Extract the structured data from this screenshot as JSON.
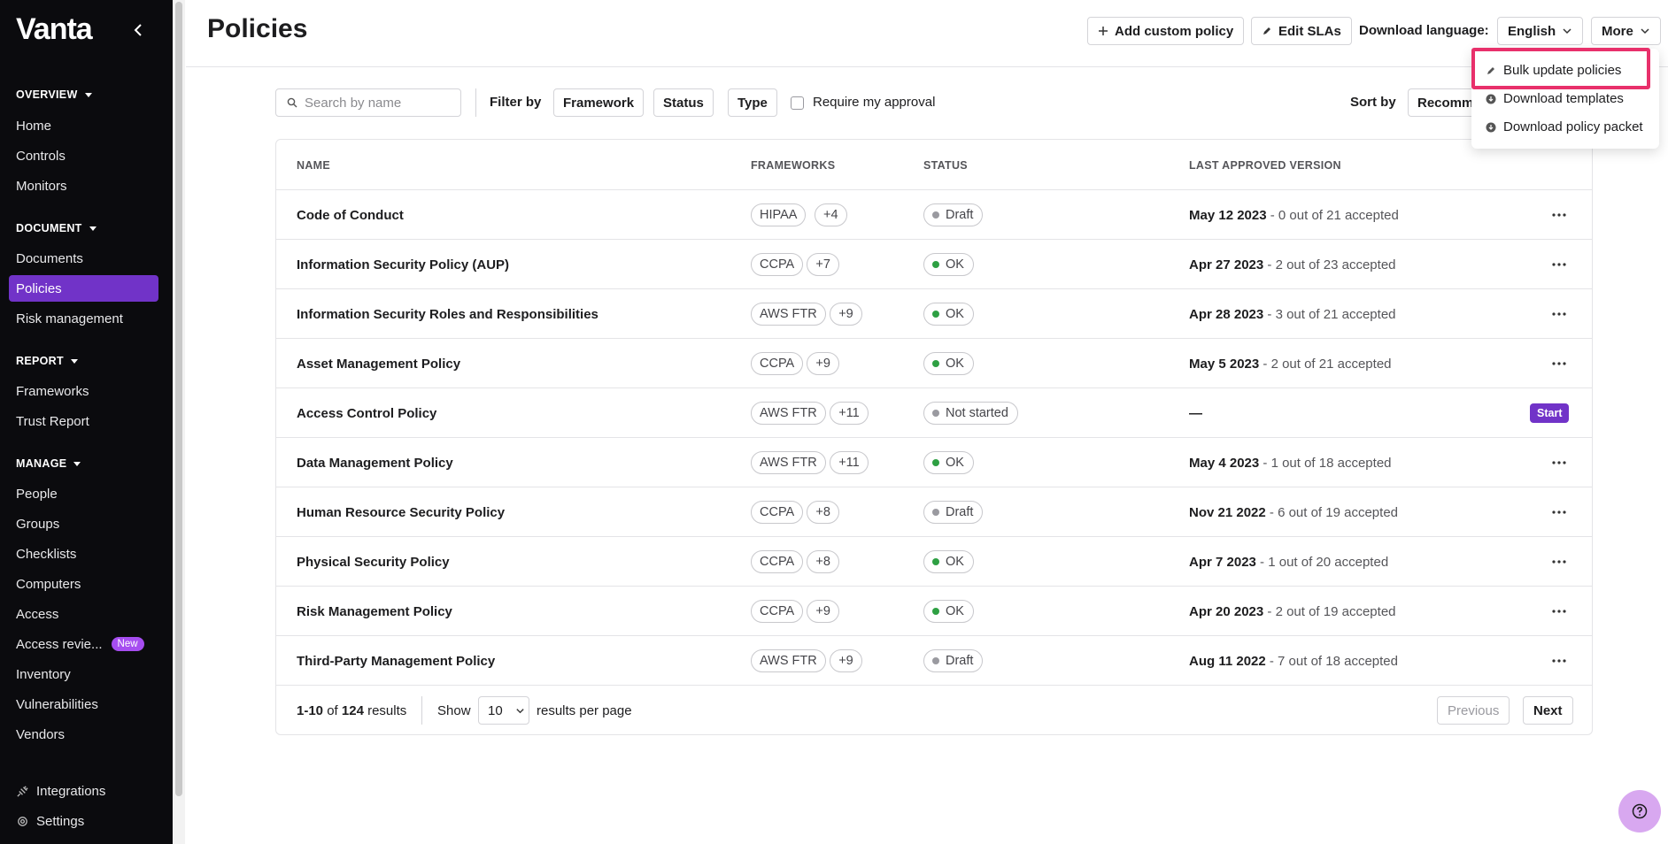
{
  "sidebar": {
    "logo": "Vanta",
    "sections": {
      "overview": "OVERVIEW",
      "document": "DOCUMENT",
      "report": "REPORT",
      "manage": "MANAGE"
    },
    "items": {
      "home": "Home",
      "controls": "Controls",
      "monitors": "Monitors",
      "documents": "Documents",
      "policies": "Policies",
      "risk": "Risk management",
      "frameworks": "Frameworks",
      "trust": "Trust Report",
      "people": "People",
      "groups": "Groups",
      "checklists": "Checklists",
      "computers": "Computers",
      "access": "Access",
      "access_reviews": "Access revie...",
      "access_reviews_badge": "New",
      "inventory": "Inventory",
      "vulnerabilities": "Vulnerabilities",
      "vendors": "Vendors"
    },
    "bottom": {
      "integrations": "Integrations",
      "settings": "Settings"
    }
  },
  "header": {
    "title": "Policies",
    "add_custom": "Add custom policy",
    "edit_slas": "Edit SLAs",
    "download_language_label": "Download language:",
    "language": "English",
    "more": "More"
  },
  "more_menu": {
    "bulk_update": "Bulk update policies",
    "download_templates": "Download templates",
    "download_packet": "Download policy packet"
  },
  "filters": {
    "search_placeholder": "Search by name",
    "filter_by": "Filter by",
    "framework": "Framework",
    "status": "Status",
    "type": "Type",
    "require_approval": "Require my approval",
    "sort_by": "Sort by",
    "sort_value": "Recomm"
  },
  "table": {
    "headers": {
      "name": "NAME",
      "frameworks": "FRAMEWORKS",
      "status": "STATUS",
      "last_approved": "LAST APPROVED VERSION"
    },
    "rows": [
      {
        "name": "Code of Conduct",
        "fw": "HIPAA",
        "more": "+4",
        "status": "Draft",
        "date": "May 12 2023",
        "accepted": " - 0 out of 21 accepted"
      },
      {
        "name": "Information Security Policy (AUP)",
        "fw": "CCPA",
        "more": "+7",
        "status": "OK",
        "date": "Apr 27 2023",
        "accepted": " - 2 out of 23 accepted"
      },
      {
        "name": "Information Security Roles and Responsibilities",
        "fw": "AWS FTR",
        "more": "+9",
        "status": "OK",
        "date": "Apr 28 2023",
        "accepted": " - 3 out of 21 accepted"
      },
      {
        "name": "Asset Management Policy",
        "fw": "CCPA",
        "more": "+9",
        "status": "OK",
        "date": "May 5 2023",
        "accepted": " - 2 out of 21 accepted"
      },
      {
        "name": "Access Control Policy",
        "fw": "AWS FTR",
        "more": "+11",
        "status": "Not started",
        "date": "—",
        "accepted": "",
        "action": "Start"
      },
      {
        "name": "Data Management Policy",
        "fw": "AWS FTR",
        "more": "+11",
        "status": "OK",
        "date": "May 4 2023",
        "accepted": " - 1 out of 18 accepted"
      },
      {
        "name": "Human Resource Security Policy",
        "fw": "CCPA",
        "more": "+8",
        "status": "Draft",
        "date": "Nov 21 2022",
        "accepted": " - 6 out of 19 accepted"
      },
      {
        "name": "Physical Security Policy",
        "fw": "CCPA",
        "more": "+8",
        "status": "OK",
        "date": "Apr 7 2023",
        "accepted": " - 1 out of 20 accepted"
      },
      {
        "name": "Risk Management Policy",
        "fw": "CCPA",
        "more": "+9",
        "status": "OK",
        "date": "Apr 20 2023",
        "accepted": " - 2 out of 19 accepted"
      },
      {
        "name": "Third-Party Management Policy",
        "fw": "AWS FTR",
        "more": "+9",
        "status": "Draft",
        "date": "Aug 11 2022",
        "accepted": " - 7 out of 18 accepted"
      }
    ]
  },
  "pagination": {
    "range": "1-10",
    "of": " of ",
    "total": "124",
    "results": " results",
    "show": "Show",
    "per_page": "10",
    "per_page_label": "results per page",
    "previous": "Previous",
    "next": "Next"
  },
  "colors": {
    "accent": "#7133c8",
    "status_ok": "#2ea043",
    "status_draft": "#9a9aa0",
    "highlight": "#e8306b"
  }
}
